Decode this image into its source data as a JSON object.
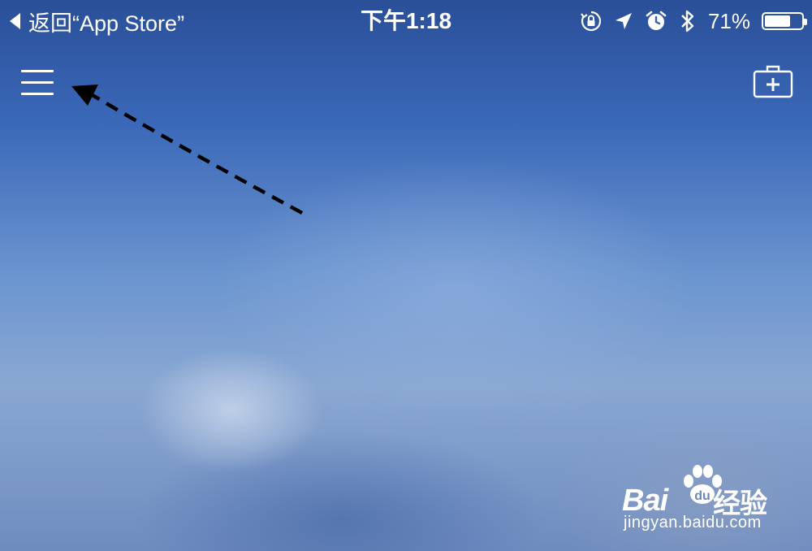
{
  "status_bar": {
    "back_label": "返回“App Store”",
    "time": "下午1:18",
    "battery_percent_label": "71%",
    "battery_level": 0.71,
    "icons": [
      "orientation-lock-icon",
      "location-arrow-icon",
      "alarm-clock-icon",
      "bluetooth-icon",
      "battery-icon"
    ]
  },
  "toolbar": {
    "left_icon": "hamburger-menu-icon",
    "right_icon": "first-aid-kit-icon"
  },
  "annotation": {
    "type": "dashed-arrow",
    "color": "#000000"
  },
  "watermark": {
    "logo_text": "Bai",
    "logo_suffix": "经验",
    "url": "jingyan.baidu.com"
  },
  "colors": {
    "background_top": "#2a4f98",
    "background_mid": "#6b95cf",
    "foreground": "#ffffff"
  }
}
